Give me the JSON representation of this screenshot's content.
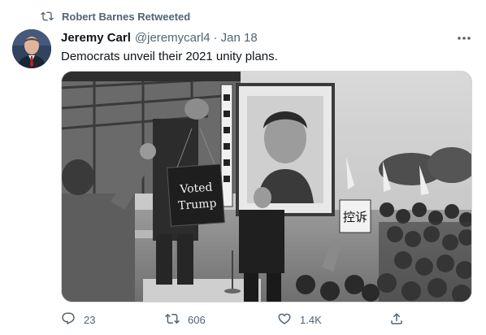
{
  "retweet_header": {
    "label": "Robert Barnes Retweeted",
    "icon": "retweet-icon"
  },
  "author": {
    "display_name": "Jeremy Carl",
    "handle": "@jeremycarl4",
    "separator": "·",
    "date": "Jan 18",
    "avatar_icon": "avatar"
  },
  "tweet": {
    "text": "Democrats unveil their 2021 unity plans."
  },
  "media": {
    "type": "black-and-white photo",
    "sign_text_line1": "Voted",
    "sign_text_line2": "Trump",
    "banner_text": "控诉"
  },
  "actions": {
    "reply": {
      "icon": "reply-icon",
      "count": "23"
    },
    "retweet": {
      "icon": "retweet-icon",
      "count": "606"
    },
    "like": {
      "icon": "heart-icon",
      "count": "1.4K"
    },
    "share": {
      "icon": "share-icon"
    }
  },
  "more_icon": "more-icon",
  "colors": {
    "secondary": "#536471",
    "primary": "#0f1419",
    "border": "#cfd9de"
  }
}
